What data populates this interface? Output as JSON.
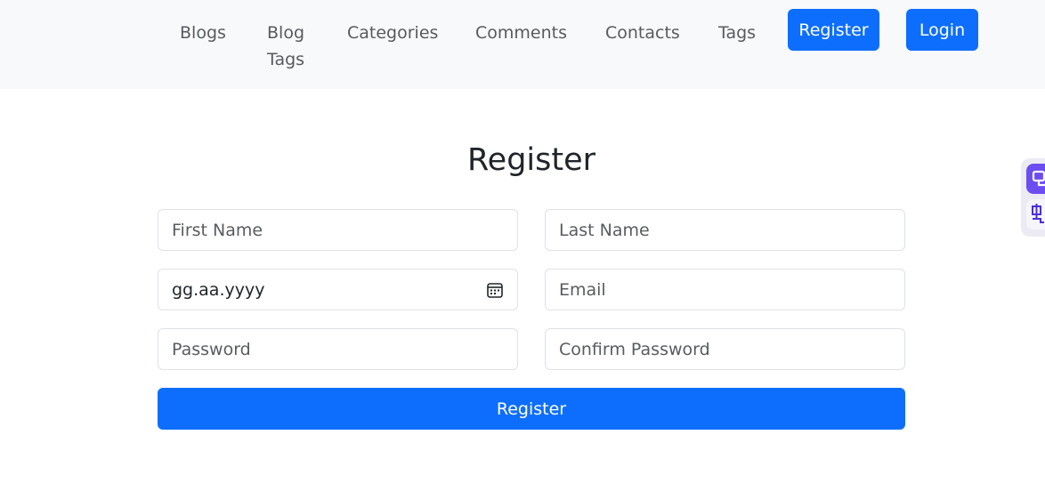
{
  "nav": {
    "items": [
      {
        "label": "Blogs"
      },
      {
        "label": "Blog Tags"
      },
      {
        "label": "Categories"
      },
      {
        "label": "Comments"
      },
      {
        "label": "Contacts"
      },
      {
        "label": "Tags"
      }
    ],
    "register_label": "Register",
    "login_label": "Login"
  },
  "form": {
    "title": "Register",
    "first_name_placeholder": "First Name",
    "last_name_placeholder": "Last Name",
    "date_value": "gg.aa.yyyy",
    "email_placeholder": "Email",
    "password_placeholder": "Password",
    "confirm_password_placeholder": "Confirm Password",
    "submit_label": "Register"
  },
  "colors": {
    "primary": "#0d6efd",
    "navbar_bg": "#f8f9fa",
    "side_widget_accent": "#6b4df0"
  },
  "icons": {
    "date_picker": "calendar-icon",
    "side_widget_top": "extension-icon",
    "side_widget_bottom": "translate-icon"
  }
}
